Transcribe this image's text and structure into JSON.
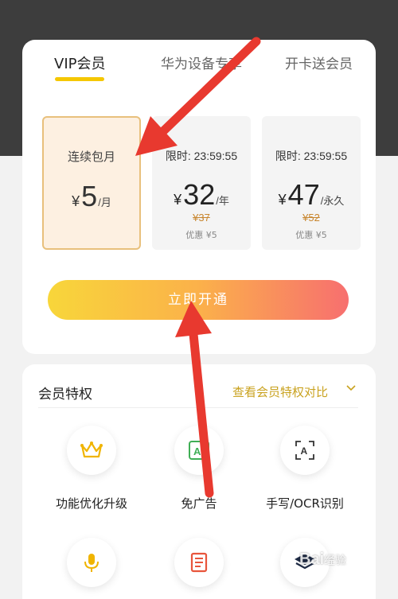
{
  "tabs": [
    {
      "label": "VIP会员",
      "active": true
    },
    {
      "label": "华为设备专享",
      "active": false
    },
    {
      "label": "开卡送会员",
      "active": false
    }
  ],
  "plans": [
    {
      "name": "连续包月",
      "currency": "¥",
      "amount": "5",
      "unit": "/月",
      "selected": true
    },
    {
      "timer": "限时: 23:59:55",
      "currency": "¥",
      "amount": "32",
      "unit": "/年",
      "original": "¥37",
      "discount": "优惠 ¥5"
    },
    {
      "timer": "限时: 23:59:55",
      "currency": "¥",
      "amount": "47",
      "unit": "/永久",
      "original": "¥52",
      "discount": "优惠 ¥5"
    }
  ],
  "cta_label": "立即开通",
  "privileges": {
    "title": "会员特权",
    "compare_link": "查看会员特权对比",
    "items": [
      {
        "label": "功能优化升级",
        "icon": "crown-icon"
      },
      {
        "label": "免广告",
        "icon": "ad-free-icon"
      },
      {
        "label": "手写/OCR识别",
        "icon": "ocr-scan-icon"
      },
      {
        "label": "",
        "icon": "microphone-icon"
      },
      {
        "label": "",
        "icon": "document-icon"
      },
      {
        "label": "",
        "icon": "layers-icon"
      }
    ]
  },
  "watermark": {
    "text": "Bai",
    "suffix": "经验"
  },
  "colors": {
    "accent": "#f5c700",
    "arrow": "#e8392f",
    "gold_text": "#c9a21f"
  }
}
